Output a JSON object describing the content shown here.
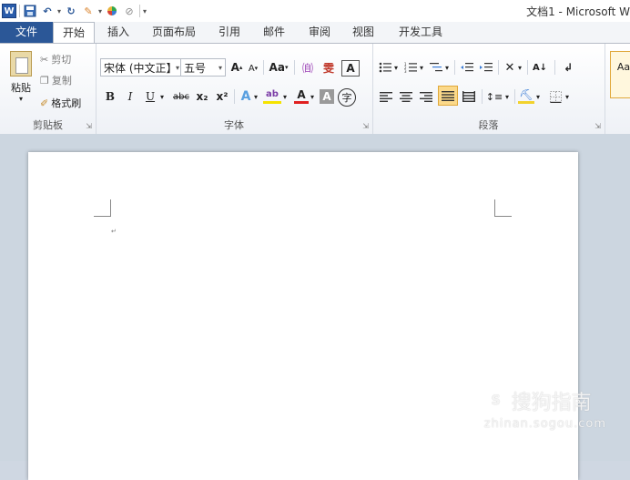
{
  "window": {
    "title": "文档1 - Microsoft W"
  },
  "qat": {
    "word_logo": "W"
  },
  "tabs": [
    "文件",
    "开始",
    "插入",
    "页面布局",
    "引用",
    "邮件",
    "审阅",
    "视图",
    "开发工具"
  ],
  "clipboard": {
    "paste": "粘贴",
    "cut": "剪切",
    "copy": "复制",
    "format_painter": "格式刷",
    "group": "剪贴板"
  },
  "font": {
    "name": "宋体 (中文正】",
    "size": "五号",
    "grow": "A",
    "shrink": "A",
    "case": "Aa",
    "bold": "B",
    "italic": "I",
    "underline": "U",
    "strike": "abc",
    "subscript": "x₂",
    "superscript": "x²",
    "highlight_text": "ab",
    "font_color_text": "A",
    "char_shade_text": "A",
    "enclose": "字",
    "group": "字体"
  },
  "paragraph": {
    "group": "段落"
  },
  "styles": {
    "preview": "Aa"
  },
  "watermark": {
    "main": "搜狗指南",
    "logo": "S",
    "sub": "zhinan.sogou.com"
  }
}
